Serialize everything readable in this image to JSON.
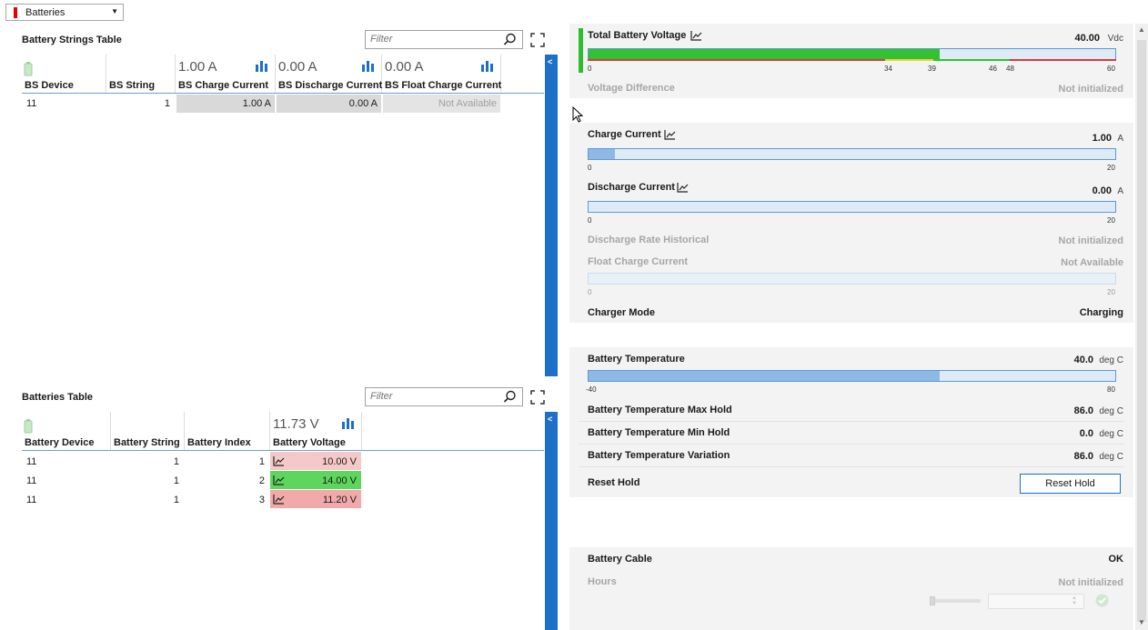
{
  "dropdown": {
    "selected": "Batteries"
  },
  "strings_table": {
    "title": "Battery Strings Table",
    "filter_placeholder": "Filter",
    "columns": [
      "BS Device",
      "BS String",
      "BS Charge Current",
      "BS Discharge Current",
      "BS Float Charge Current"
    ],
    "summaries": [
      "1.00 A",
      "0.00 A",
      "0.00 A"
    ],
    "rows": [
      {
        "device": "11",
        "string": "1",
        "charge": "1.00 A",
        "discharge": "0.00 A",
        "float": "Not Available"
      }
    ]
  },
  "batteries_table": {
    "title": "Batteries Table",
    "filter_placeholder": "Filter",
    "columns": [
      "Battery Device",
      "Battery String",
      "Battery Index",
      "Battery Voltage"
    ],
    "summary": "11.73 V",
    "rows": [
      {
        "device": "11",
        "string": "1",
        "index": "1",
        "voltage": "10.00 V",
        "status_color": "#f6c9c9"
      },
      {
        "device": "11",
        "string": "1",
        "index": "2",
        "voltage": "14.00 V",
        "status_color": "#5cd65c"
      },
      {
        "device": "11",
        "string": "1",
        "index": "3",
        "voltage": "11.20 V",
        "status_color": "#f2a9a9"
      }
    ]
  },
  "right": {
    "total_voltage": {
      "label": "Total Battery Voltage",
      "value": "40.00",
      "unit": "Vdc",
      "fill_fraction": 0.667,
      "ticks": [
        "0",
        "34",
        "39",
        "46",
        "48",
        "60"
      ]
    },
    "voltage_difference": {
      "label": "Voltage Difference",
      "value": "Not initialized"
    },
    "charge_current": {
      "label": "Charge Current",
      "value": "1.00",
      "unit": "A",
      "fill_fraction": 0.05,
      "ticks": [
        "0",
        "20"
      ]
    },
    "discharge_current": {
      "label": "Discharge Current",
      "value": "0.00",
      "unit": "A",
      "fill_fraction": 0.0,
      "ticks": [
        "0",
        "20"
      ]
    },
    "discharge_rate": {
      "label": "Discharge Rate Historical",
      "value": "Not initialized"
    },
    "float_charge": {
      "label": "Float Charge Current",
      "value": "Not Available",
      "ticks": [
        "0",
        "20"
      ]
    },
    "charger_mode": {
      "label": "Charger Mode",
      "value": "Charging"
    },
    "temperature": {
      "label": "Battery Temperature",
      "value": "40.0",
      "unit": "deg C",
      "fill_fraction": 0.667,
      "ticks": [
        "-40",
        "80"
      ]
    },
    "temp_max": {
      "label": "Battery Temperature Max Hold",
      "value": "86.0",
      "unit": "deg C"
    },
    "temp_min": {
      "label": "Battery Temperature Min Hold",
      "value": "0.0",
      "unit": "deg C"
    },
    "temp_var": {
      "label": "Battery Temperature Variation",
      "value": "86.0",
      "unit": "deg C"
    },
    "reset_hold": {
      "label": "Reset Hold",
      "button": "Reset Hold"
    },
    "cable": {
      "label": "Battery Cable",
      "value": "OK"
    },
    "hours": {
      "label": "Hours",
      "value": "Not initialized"
    }
  },
  "colors": {
    "accent": "#1e6fc8",
    "ok_green": "#2ebd2e",
    "gauge_bg": "#deebf7",
    "gauge_fill": "#8fb8e4"
  }
}
